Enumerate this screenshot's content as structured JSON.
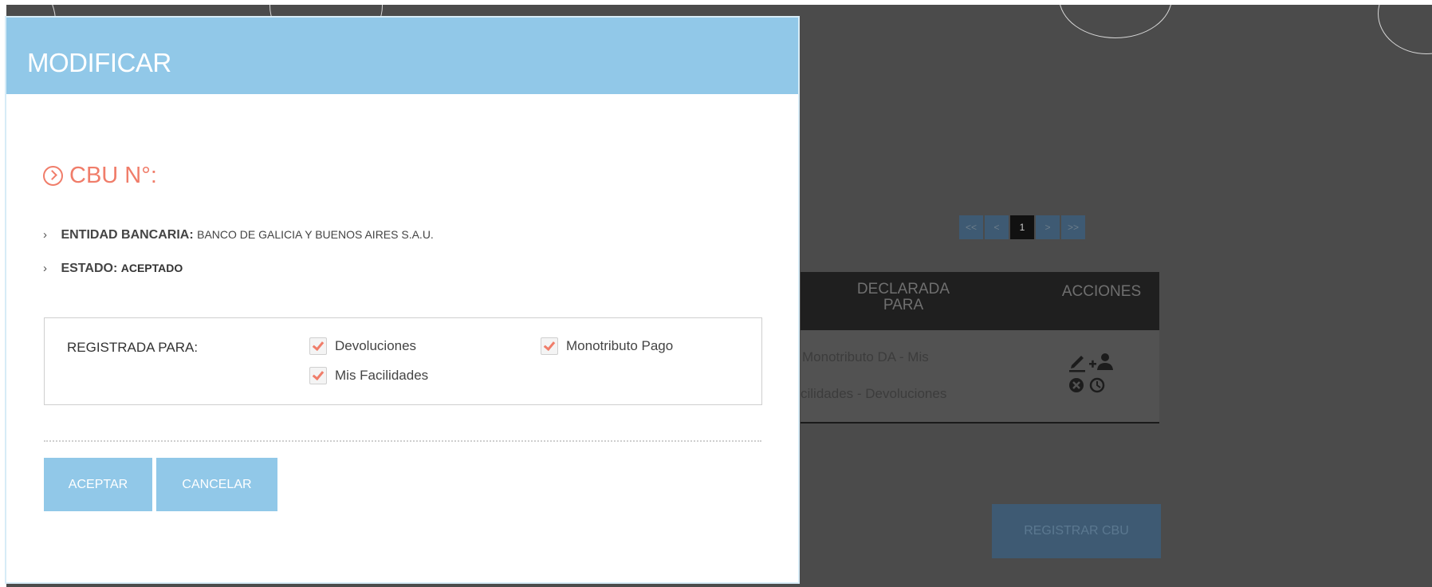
{
  "modal": {
    "title": "MODIFICAR",
    "cbu_label": "CBU N°:",
    "entidad_label": "ENTIDAD BANCARIA:",
    "entidad_value": "BANCO DE GALICIA Y BUENOS AIRES S.A.U.",
    "estado_label": "ESTADO:",
    "estado_value": "ACEPTADO",
    "registrada_label": "REGISTRADA PARA:",
    "checkboxes": [
      {
        "label": "Devoluciones",
        "checked": true
      },
      {
        "label": "Monotributo Pago",
        "checked": true
      },
      {
        "label": "Mis Facilidades",
        "checked": true
      }
    ],
    "accept_label": "ACEPTAR",
    "cancel_label": "CANCELAR"
  },
  "background": {
    "pager": [
      "<<",
      "<",
      "1",
      ">",
      ">>"
    ],
    "table": {
      "headers": [
        "DECLARADA PARA",
        "ACCIONES"
      ],
      "declarada_line1": "Monotributo DA - Mis",
      "declarada_line2": "cilidades - Devoluciones"
    },
    "register_button": "REGISTRAR CBU"
  },
  "colors": {
    "modal_header": "#91c8e8",
    "accent": "#f07d6a",
    "overlay": "#4b4b4b"
  }
}
